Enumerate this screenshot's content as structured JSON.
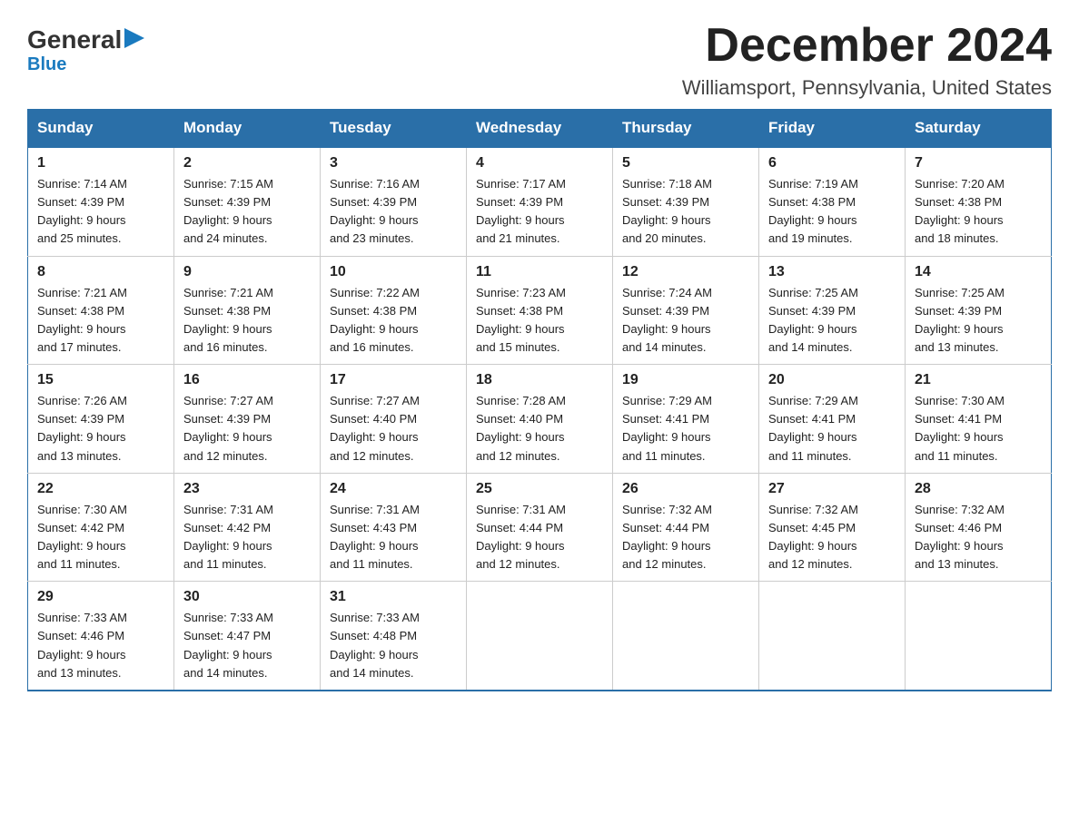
{
  "logo": {
    "text_black": "General",
    "triangle": "▶",
    "text_blue": "Blue"
  },
  "title": "December 2024",
  "subtitle": "Williamsport, Pennsylvania, United States",
  "days_of_week": [
    "Sunday",
    "Monday",
    "Tuesday",
    "Wednesday",
    "Thursday",
    "Friday",
    "Saturday"
  ],
  "weeks": [
    [
      {
        "day": "1",
        "sunrise": "7:14 AM",
        "sunset": "4:39 PM",
        "daylight": "9 hours and 25 minutes."
      },
      {
        "day": "2",
        "sunrise": "7:15 AM",
        "sunset": "4:39 PM",
        "daylight": "9 hours and 24 minutes."
      },
      {
        "day": "3",
        "sunrise": "7:16 AM",
        "sunset": "4:39 PM",
        "daylight": "9 hours and 23 minutes."
      },
      {
        "day": "4",
        "sunrise": "7:17 AM",
        "sunset": "4:39 PM",
        "daylight": "9 hours and 21 minutes."
      },
      {
        "day": "5",
        "sunrise": "7:18 AM",
        "sunset": "4:39 PM",
        "daylight": "9 hours and 20 minutes."
      },
      {
        "day": "6",
        "sunrise": "7:19 AM",
        "sunset": "4:38 PM",
        "daylight": "9 hours and 19 minutes."
      },
      {
        "day": "7",
        "sunrise": "7:20 AM",
        "sunset": "4:38 PM",
        "daylight": "9 hours and 18 minutes."
      }
    ],
    [
      {
        "day": "8",
        "sunrise": "7:21 AM",
        "sunset": "4:38 PM",
        "daylight": "9 hours and 17 minutes."
      },
      {
        "day": "9",
        "sunrise": "7:21 AM",
        "sunset": "4:38 PM",
        "daylight": "9 hours and 16 minutes."
      },
      {
        "day": "10",
        "sunrise": "7:22 AM",
        "sunset": "4:38 PM",
        "daylight": "9 hours and 16 minutes."
      },
      {
        "day": "11",
        "sunrise": "7:23 AM",
        "sunset": "4:38 PM",
        "daylight": "9 hours and 15 minutes."
      },
      {
        "day": "12",
        "sunrise": "7:24 AM",
        "sunset": "4:39 PM",
        "daylight": "9 hours and 14 minutes."
      },
      {
        "day": "13",
        "sunrise": "7:25 AM",
        "sunset": "4:39 PM",
        "daylight": "9 hours and 14 minutes."
      },
      {
        "day": "14",
        "sunrise": "7:25 AM",
        "sunset": "4:39 PM",
        "daylight": "9 hours and 13 minutes."
      }
    ],
    [
      {
        "day": "15",
        "sunrise": "7:26 AM",
        "sunset": "4:39 PM",
        "daylight": "9 hours and 13 minutes."
      },
      {
        "day": "16",
        "sunrise": "7:27 AM",
        "sunset": "4:39 PM",
        "daylight": "9 hours and 12 minutes."
      },
      {
        "day": "17",
        "sunrise": "7:27 AM",
        "sunset": "4:40 PM",
        "daylight": "9 hours and 12 minutes."
      },
      {
        "day": "18",
        "sunrise": "7:28 AM",
        "sunset": "4:40 PM",
        "daylight": "9 hours and 12 minutes."
      },
      {
        "day": "19",
        "sunrise": "7:29 AM",
        "sunset": "4:41 PM",
        "daylight": "9 hours and 11 minutes."
      },
      {
        "day": "20",
        "sunrise": "7:29 AM",
        "sunset": "4:41 PM",
        "daylight": "9 hours and 11 minutes."
      },
      {
        "day": "21",
        "sunrise": "7:30 AM",
        "sunset": "4:41 PM",
        "daylight": "9 hours and 11 minutes."
      }
    ],
    [
      {
        "day": "22",
        "sunrise": "7:30 AM",
        "sunset": "4:42 PM",
        "daylight": "9 hours and 11 minutes."
      },
      {
        "day": "23",
        "sunrise": "7:31 AM",
        "sunset": "4:42 PM",
        "daylight": "9 hours and 11 minutes."
      },
      {
        "day": "24",
        "sunrise": "7:31 AM",
        "sunset": "4:43 PM",
        "daylight": "9 hours and 11 minutes."
      },
      {
        "day": "25",
        "sunrise": "7:31 AM",
        "sunset": "4:44 PM",
        "daylight": "9 hours and 12 minutes."
      },
      {
        "day": "26",
        "sunrise": "7:32 AM",
        "sunset": "4:44 PM",
        "daylight": "9 hours and 12 minutes."
      },
      {
        "day": "27",
        "sunrise": "7:32 AM",
        "sunset": "4:45 PM",
        "daylight": "9 hours and 12 minutes."
      },
      {
        "day": "28",
        "sunrise": "7:32 AM",
        "sunset": "4:46 PM",
        "daylight": "9 hours and 13 minutes."
      }
    ],
    [
      {
        "day": "29",
        "sunrise": "7:33 AM",
        "sunset": "4:46 PM",
        "daylight": "9 hours and 13 minutes."
      },
      {
        "day": "30",
        "sunrise": "7:33 AM",
        "sunset": "4:47 PM",
        "daylight": "9 hours and 14 minutes."
      },
      {
        "day": "31",
        "sunrise": "7:33 AM",
        "sunset": "4:48 PM",
        "daylight": "9 hours and 14 minutes."
      },
      null,
      null,
      null,
      null
    ]
  ],
  "labels": {
    "sunrise": "Sunrise:",
    "sunset": "Sunset:",
    "daylight": "Daylight:"
  }
}
